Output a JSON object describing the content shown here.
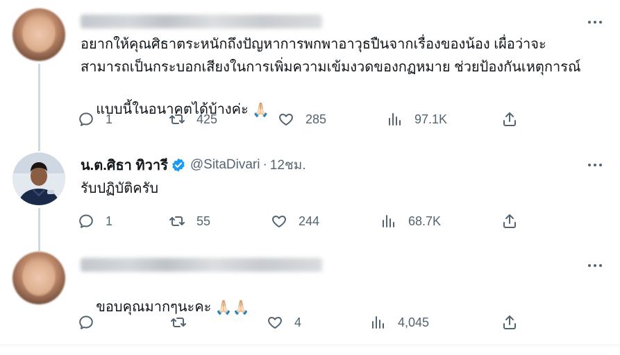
{
  "tweets": [
    {
      "author_blurred": true,
      "text_lines": [
        "อยากให้คุณศิธาตระหนักถึงปัญหาการพกพาอาวุธปืนจากเรื่องของน้อง เผื่อว่าจะ",
        "สามารถเป็นกระบอกเสียงในการเพิ่มความเข้มงวดของกฏหมาย ช่วยป้องกันเหตุการณ์",
        "แบบนี้ในอนาคตได้บ้างค่ะ"
      ],
      "emoji": "🙏🏻",
      "stats": {
        "replies": "1",
        "retweets": "425",
        "likes": "285",
        "views": "97.1K"
      }
    },
    {
      "display_name": "น.ต.ศิธา ทิวารี",
      "handle": "@SitaDivari",
      "separator": "·",
      "time": "12ชม.",
      "text": "รับปฏิบัติครับ",
      "stats": {
        "replies": "1",
        "retweets": "55",
        "likes": "244",
        "views": "68.7K"
      }
    },
    {
      "author_blurred": true,
      "text": "ขอบคุณมากๆนะคะ",
      "emoji": "🙏🏻🙏🏻",
      "stats": {
        "replies": "",
        "retweets": "",
        "likes": "4",
        "views": "4,045"
      }
    }
  ],
  "icons": [
    "reply-icon",
    "retweet-icon",
    "like-icon",
    "views-icon",
    "share-icon",
    "more-icon",
    "verified-badge-icon"
  ],
  "colors": {
    "text": "#0f1419",
    "muted": "#536471",
    "verified": "#1d9bf0",
    "thread_line": "#cfd9de"
  }
}
